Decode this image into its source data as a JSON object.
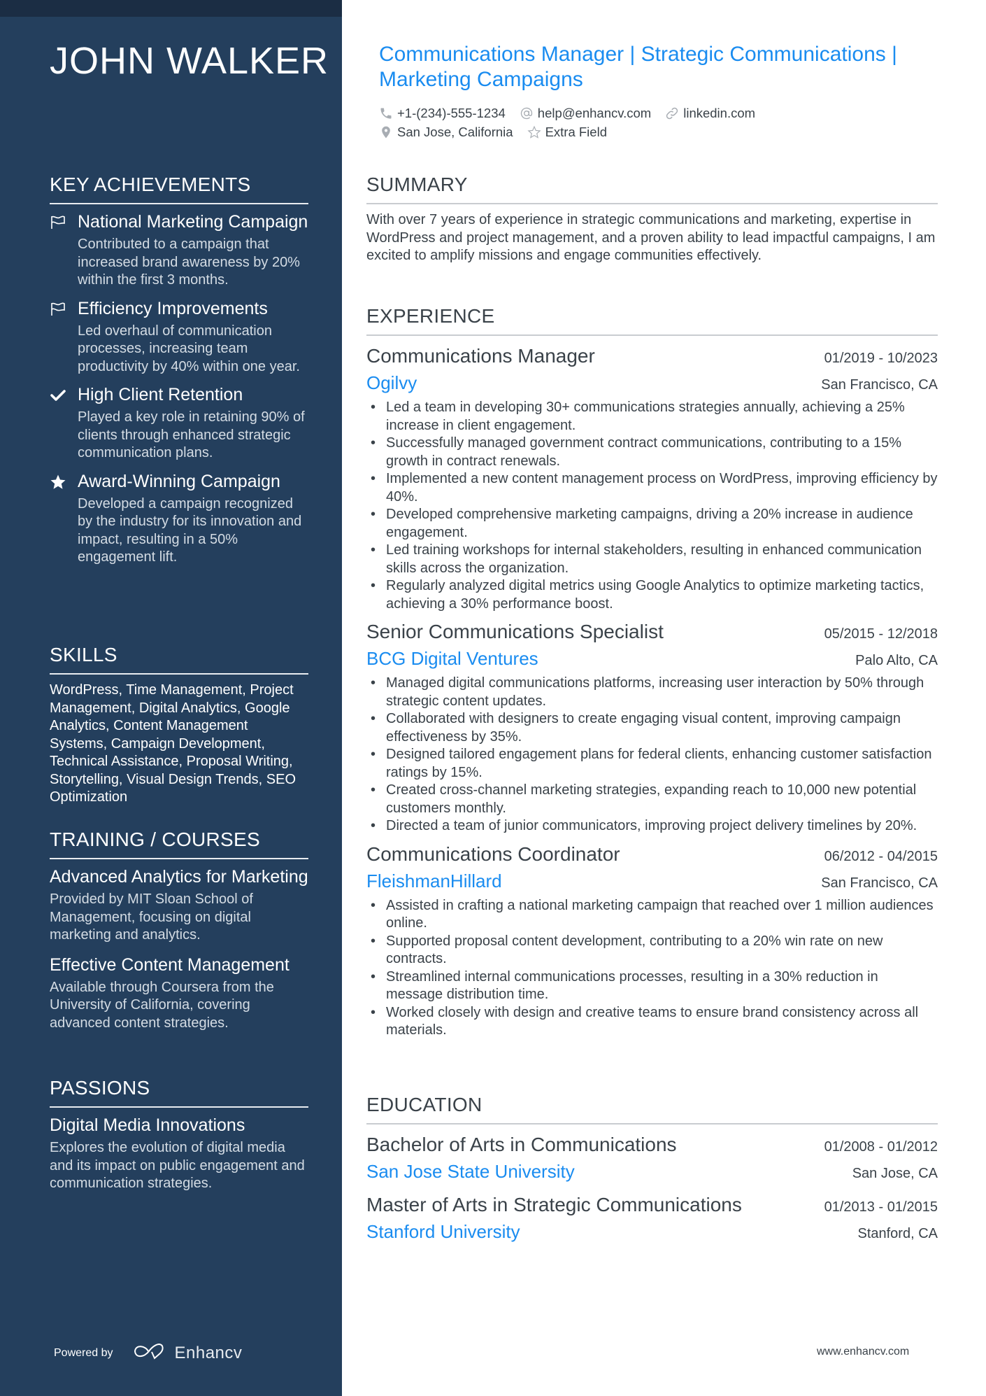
{
  "name": "JOHN WALKER",
  "headline": "Communications Manager | Strategic Communications | Marketing Campaigns",
  "contacts": {
    "phone": "+1-(234)-555-1234",
    "email": "help@enhancv.com",
    "linkedin": "linkedin.com",
    "location": "San Jose, California",
    "extra": "Extra Field"
  },
  "sidebar": {
    "achievements": {
      "heading": "KEY ACHIEVEMENTS",
      "items": [
        {
          "icon": "flag-icon",
          "title": "National Marketing Campaign",
          "desc": "Contributed to a campaign that increased brand awareness by 20% within the first 3 months."
        },
        {
          "icon": "flag-icon",
          "title": "Efficiency Improvements",
          "desc": "Led overhaul of communication processes, increasing team productivity by 40% within one year."
        },
        {
          "icon": "check-icon",
          "title": "High Client Retention",
          "desc": "Played a key role in retaining 90% of clients through enhanced strategic communication plans."
        },
        {
          "icon": "star-icon",
          "title": "Award-Winning Campaign",
          "desc": "Developed a campaign recognized by the industry for its innovation and impact, resulting in a 50% engagement lift."
        }
      ]
    },
    "skills": {
      "heading": "SKILLS",
      "text": "WordPress, Time Management, Project Management, Digital Analytics, Google Analytics, Content Management Systems, Campaign Development, Technical Assistance, Proposal Writing, Storytelling, Visual Design Trends, SEO Optimization"
    },
    "training": {
      "heading": "TRAINING / COURSES",
      "items": [
        {
          "title": "Advanced Analytics for Marketing",
          "desc": "Provided by MIT Sloan School of Management, focusing on digital marketing and analytics."
        },
        {
          "title": "Effective Content Management",
          "desc": "Available through Coursera from the University of California, covering advanced content strategies."
        }
      ]
    },
    "passions": {
      "heading": "PASSIONS",
      "items": [
        {
          "title": "Digital Media Innovations",
          "desc": "Explores the evolution of digital media and its impact on public engagement and communication strategies."
        }
      ]
    },
    "powered_by": "Powered by",
    "brand": "Enhancv"
  },
  "summary": {
    "heading": "SUMMARY",
    "text": "With over 7 years of experience in strategic communications and marketing, expertise in WordPress and project management, and a proven ability to lead impactful campaigns, I am excited to amplify missions and engage communities effectively."
  },
  "experience": {
    "heading": "EXPERIENCE",
    "jobs": [
      {
        "title": "Communications Manager",
        "dates": "01/2019 - 10/2023",
        "company": "Ogilvy",
        "location": "San Francisco, CA",
        "bullets": [
          "Led a team in developing 30+ communications strategies annually, achieving a 25% increase in client engagement.",
          "Successfully managed government contract communications, contributing to a 15% growth in contract renewals.",
          "Implemented a new content management process on WordPress, improving efficiency by 40%.",
          "Developed comprehensive marketing campaigns, driving a 20% increase in audience engagement.",
          "Led training workshops for internal stakeholders, resulting in enhanced communication skills across the organization.",
          "Regularly analyzed digital metrics using Google Analytics to optimize marketing tactics, achieving a 30% performance boost."
        ]
      },
      {
        "title": "Senior Communications Specialist",
        "dates": "05/2015 - 12/2018",
        "company": "BCG Digital Ventures",
        "location": "Palo Alto, CA",
        "bullets": [
          "Managed digital communications platforms, increasing user interaction by 50% through strategic content updates.",
          "Collaborated with designers to create engaging visual content, improving campaign effectiveness by 35%.",
          "Designed tailored engagement plans for federal clients, enhancing customer satisfaction ratings by 15%.",
          "Created cross-channel marketing strategies, expanding reach to 10,000 new potential customers monthly.",
          "Directed a team of junior communicators, improving project delivery timelines by 20%."
        ]
      },
      {
        "title": "Communications Coordinator",
        "dates": "06/2012 - 04/2015",
        "company": "FleishmanHillard",
        "location": "San Francisco, CA",
        "bullets": [
          "Assisted in crafting a national marketing campaign that reached over 1 million audiences online.",
          "Supported proposal content development, contributing to a 20% win rate on new contracts.",
          "Streamlined internal communications processes, resulting in a 30% reduction in message distribution time.",
          "Worked closely with design and creative teams to ensure brand consistency across all materials."
        ]
      }
    ]
  },
  "education": {
    "heading": "EDUCATION",
    "items": [
      {
        "degree": "Bachelor of Arts in Communications",
        "dates": "01/2008 - 01/2012",
        "school": "San Jose State University",
        "location": "San Jose, CA"
      },
      {
        "degree": "Master of Arts in Strategic Communications",
        "dates": "01/2013 - 01/2015",
        "school": "Stanford University",
        "location": "Stanford, CA"
      }
    ]
  },
  "footer_url": "www.enhancv.com",
  "colors": {
    "sidebar": "#243f5d",
    "accent": "#1a8cf0",
    "text": "#3a4249"
  }
}
